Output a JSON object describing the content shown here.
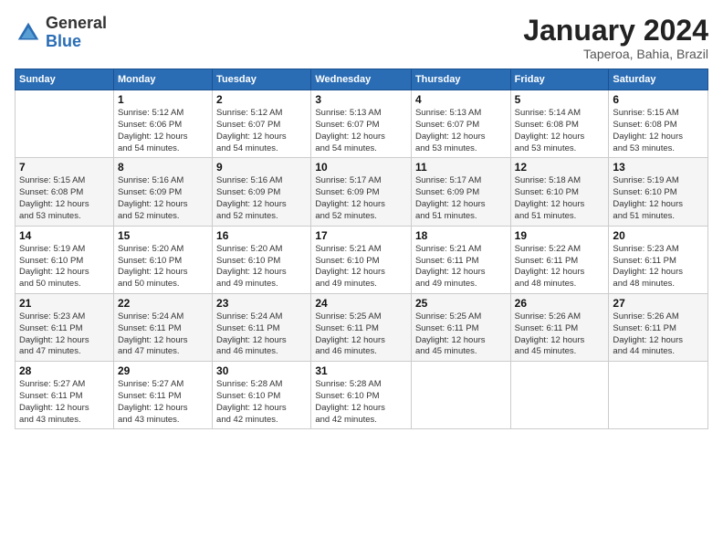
{
  "logo": {
    "general": "General",
    "blue": "Blue"
  },
  "title": "January 2024",
  "location": "Taperoa, Bahia, Brazil",
  "days_header": [
    "Sunday",
    "Monday",
    "Tuesday",
    "Wednesday",
    "Thursday",
    "Friday",
    "Saturday"
  ],
  "weeks": [
    [
      {
        "num": "",
        "info": ""
      },
      {
        "num": "1",
        "info": "Sunrise: 5:12 AM\nSunset: 6:06 PM\nDaylight: 12 hours\nand 54 minutes."
      },
      {
        "num": "2",
        "info": "Sunrise: 5:12 AM\nSunset: 6:07 PM\nDaylight: 12 hours\nand 54 minutes."
      },
      {
        "num": "3",
        "info": "Sunrise: 5:13 AM\nSunset: 6:07 PM\nDaylight: 12 hours\nand 54 minutes."
      },
      {
        "num": "4",
        "info": "Sunrise: 5:13 AM\nSunset: 6:07 PM\nDaylight: 12 hours\nand 53 minutes."
      },
      {
        "num": "5",
        "info": "Sunrise: 5:14 AM\nSunset: 6:08 PM\nDaylight: 12 hours\nand 53 minutes."
      },
      {
        "num": "6",
        "info": "Sunrise: 5:15 AM\nSunset: 6:08 PM\nDaylight: 12 hours\nand 53 minutes."
      }
    ],
    [
      {
        "num": "7",
        "info": "Sunrise: 5:15 AM\nSunset: 6:08 PM\nDaylight: 12 hours\nand 53 minutes."
      },
      {
        "num": "8",
        "info": "Sunrise: 5:16 AM\nSunset: 6:09 PM\nDaylight: 12 hours\nand 52 minutes."
      },
      {
        "num": "9",
        "info": "Sunrise: 5:16 AM\nSunset: 6:09 PM\nDaylight: 12 hours\nand 52 minutes."
      },
      {
        "num": "10",
        "info": "Sunrise: 5:17 AM\nSunset: 6:09 PM\nDaylight: 12 hours\nand 52 minutes."
      },
      {
        "num": "11",
        "info": "Sunrise: 5:17 AM\nSunset: 6:09 PM\nDaylight: 12 hours\nand 51 minutes."
      },
      {
        "num": "12",
        "info": "Sunrise: 5:18 AM\nSunset: 6:10 PM\nDaylight: 12 hours\nand 51 minutes."
      },
      {
        "num": "13",
        "info": "Sunrise: 5:19 AM\nSunset: 6:10 PM\nDaylight: 12 hours\nand 51 minutes."
      }
    ],
    [
      {
        "num": "14",
        "info": "Sunrise: 5:19 AM\nSunset: 6:10 PM\nDaylight: 12 hours\nand 50 minutes."
      },
      {
        "num": "15",
        "info": "Sunrise: 5:20 AM\nSunset: 6:10 PM\nDaylight: 12 hours\nand 50 minutes."
      },
      {
        "num": "16",
        "info": "Sunrise: 5:20 AM\nSunset: 6:10 PM\nDaylight: 12 hours\nand 49 minutes."
      },
      {
        "num": "17",
        "info": "Sunrise: 5:21 AM\nSunset: 6:10 PM\nDaylight: 12 hours\nand 49 minutes."
      },
      {
        "num": "18",
        "info": "Sunrise: 5:21 AM\nSunset: 6:11 PM\nDaylight: 12 hours\nand 49 minutes."
      },
      {
        "num": "19",
        "info": "Sunrise: 5:22 AM\nSunset: 6:11 PM\nDaylight: 12 hours\nand 48 minutes."
      },
      {
        "num": "20",
        "info": "Sunrise: 5:23 AM\nSunset: 6:11 PM\nDaylight: 12 hours\nand 48 minutes."
      }
    ],
    [
      {
        "num": "21",
        "info": "Sunrise: 5:23 AM\nSunset: 6:11 PM\nDaylight: 12 hours\nand 47 minutes."
      },
      {
        "num": "22",
        "info": "Sunrise: 5:24 AM\nSunset: 6:11 PM\nDaylight: 12 hours\nand 47 minutes."
      },
      {
        "num": "23",
        "info": "Sunrise: 5:24 AM\nSunset: 6:11 PM\nDaylight: 12 hours\nand 46 minutes."
      },
      {
        "num": "24",
        "info": "Sunrise: 5:25 AM\nSunset: 6:11 PM\nDaylight: 12 hours\nand 46 minutes."
      },
      {
        "num": "25",
        "info": "Sunrise: 5:25 AM\nSunset: 6:11 PM\nDaylight: 12 hours\nand 45 minutes."
      },
      {
        "num": "26",
        "info": "Sunrise: 5:26 AM\nSunset: 6:11 PM\nDaylight: 12 hours\nand 45 minutes."
      },
      {
        "num": "27",
        "info": "Sunrise: 5:26 AM\nSunset: 6:11 PM\nDaylight: 12 hours\nand 44 minutes."
      }
    ],
    [
      {
        "num": "28",
        "info": "Sunrise: 5:27 AM\nSunset: 6:11 PM\nDaylight: 12 hours\nand 43 minutes."
      },
      {
        "num": "29",
        "info": "Sunrise: 5:27 AM\nSunset: 6:11 PM\nDaylight: 12 hours\nand 43 minutes."
      },
      {
        "num": "30",
        "info": "Sunrise: 5:28 AM\nSunset: 6:10 PM\nDaylight: 12 hours\nand 42 minutes."
      },
      {
        "num": "31",
        "info": "Sunrise: 5:28 AM\nSunset: 6:10 PM\nDaylight: 12 hours\nand 42 minutes."
      },
      {
        "num": "",
        "info": ""
      },
      {
        "num": "",
        "info": ""
      },
      {
        "num": "",
        "info": ""
      }
    ]
  ]
}
